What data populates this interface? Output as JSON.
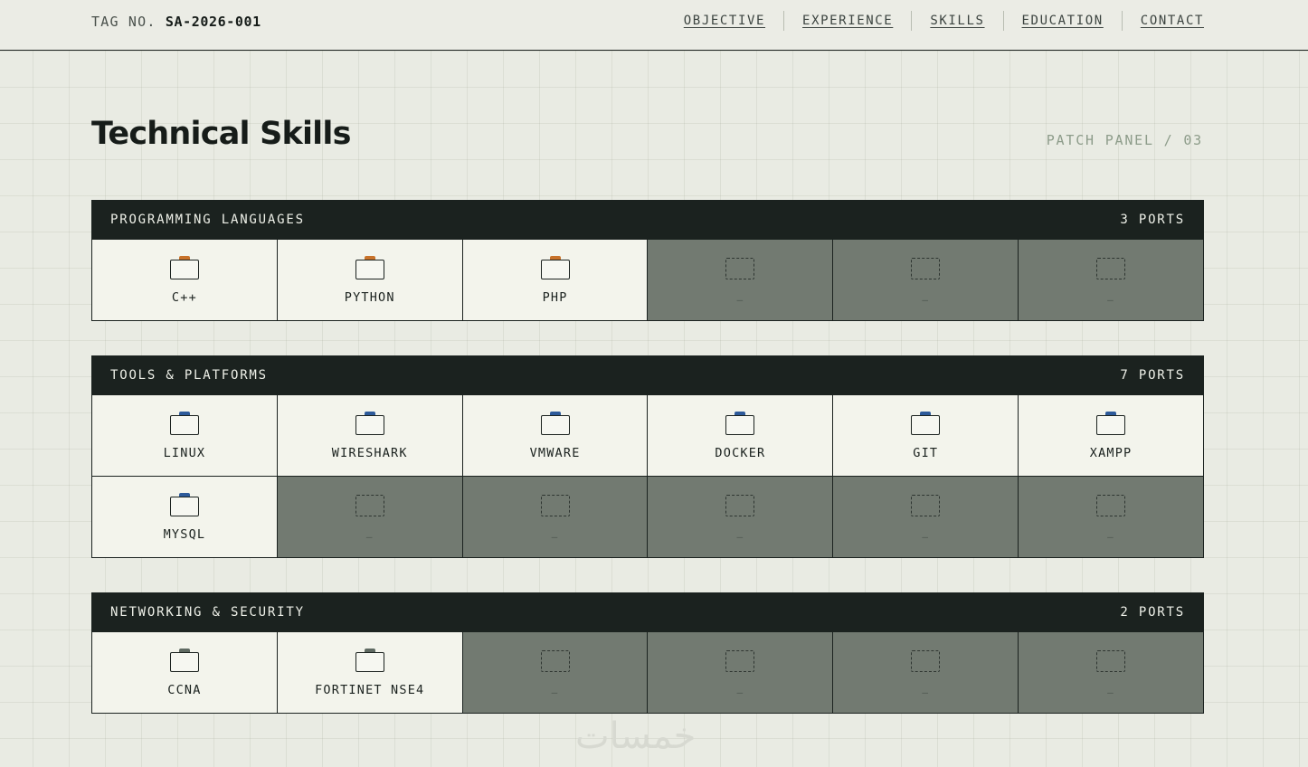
{
  "header": {
    "tag_label": "TAG NO.",
    "tag_value": "SA-2026-001",
    "nav": [
      "OBJECTIVE",
      "EXPERIENCE",
      "SKILLS",
      "EDUCATION",
      "CONTACT"
    ]
  },
  "title": "Technical Skills",
  "panel_label": "PATCH PANEL / 03",
  "empty_label": "—",
  "colors": {
    "programming": "#c8722a",
    "tools": "#2d5a9a",
    "networking": "#5f6a62"
  },
  "panels": [
    {
      "name": "PROGRAMMING LANGUAGES",
      "ports_label": "3 PORTS",
      "color_key": "programming",
      "slots": 6,
      "skills": [
        "C++",
        "PYTHON",
        "PHP"
      ]
    },
    {
      "name": "TOOLS & PLATFORMS",
      "ports_label": "7 PORTS",
      "color_key": "tools",
      "slots": 12,
      "skills": [
        "LINUX",
        "WIRESHARK",
        "VMWARE",
        "DOCKER",
        "GIT",
        "XAMPP",
        "MYSQL"
      ]
    },
    {
      "name": "NETWORKING & SECURITY",
      "ports_label": "2 PORTS",
      "color_key": "networking",
      "slots": 6,
      "skills": [
        "CCNA",
        "FORTINET NSE4"
      ]
    }
  ],
  "watermark": "خمسات"
}
